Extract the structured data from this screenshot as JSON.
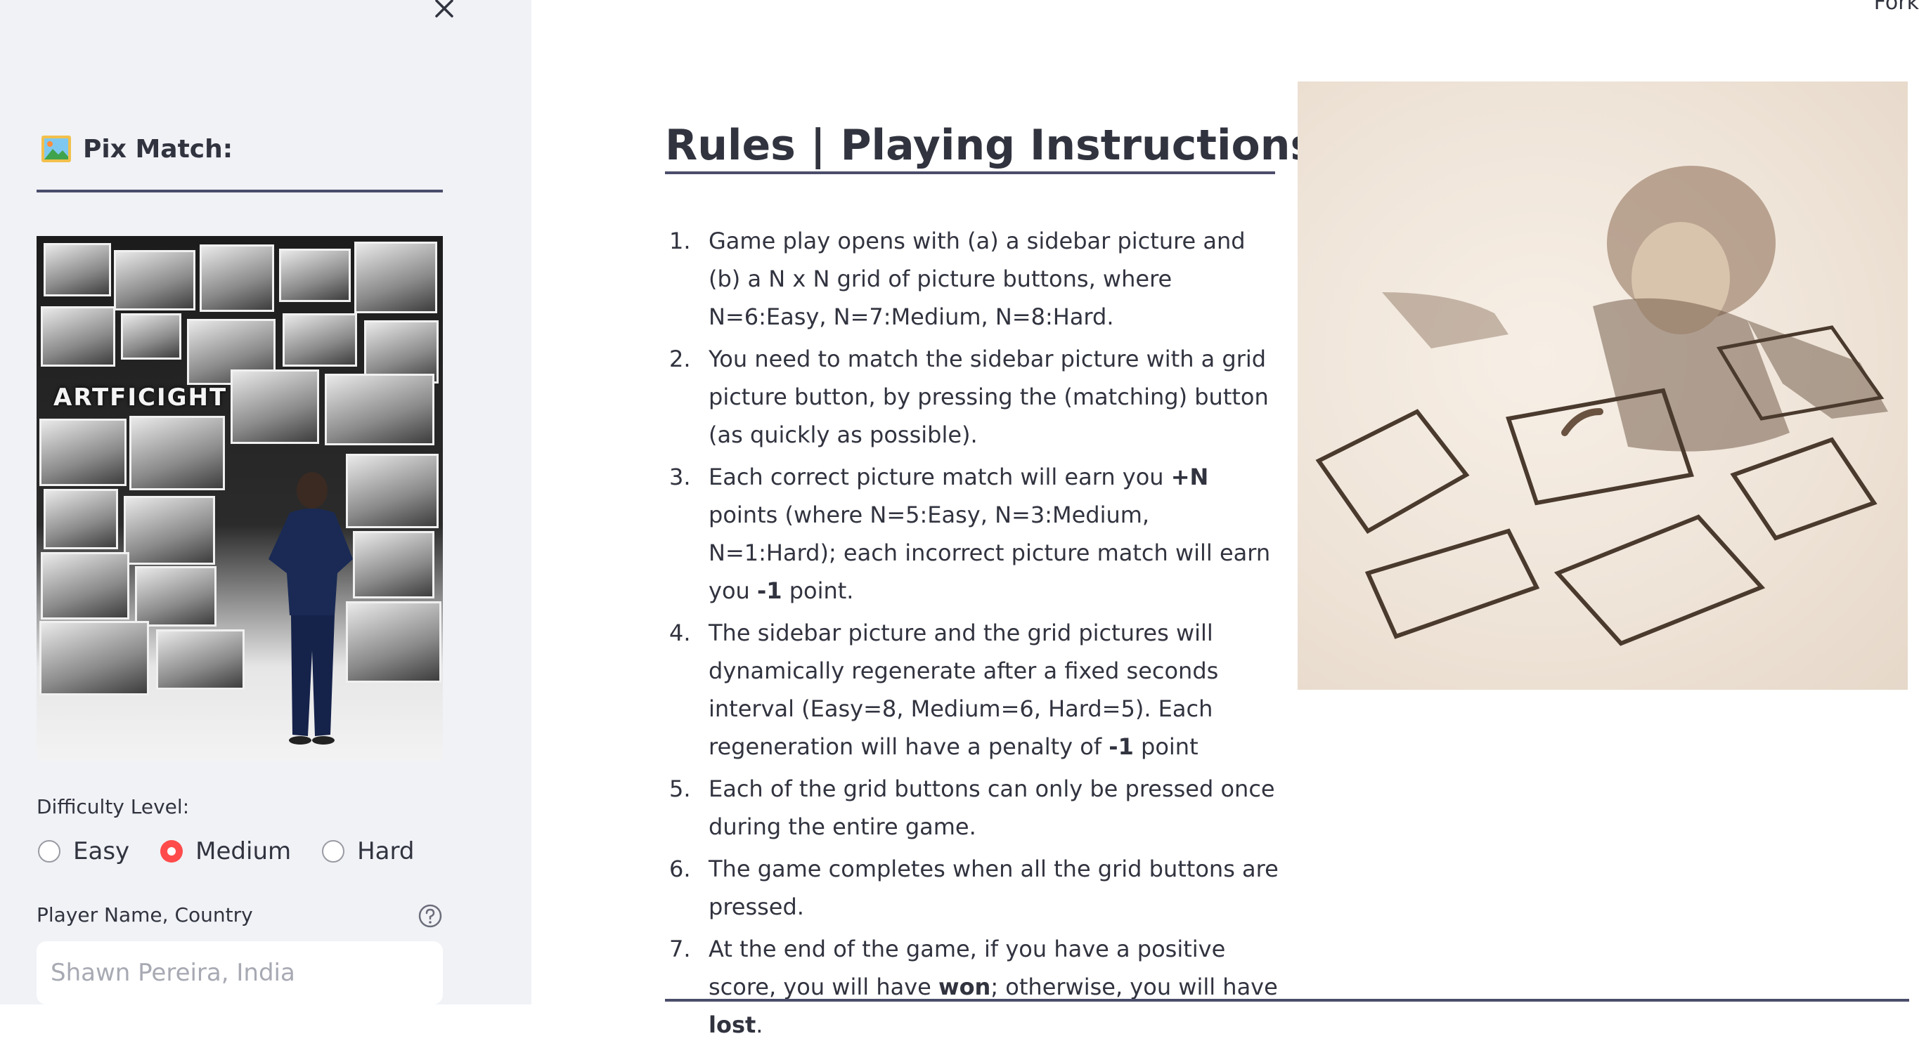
{
  "sidebar": {
    "title": "Pix Match:",
    "title_icon": "framed-picture-icon",
    "image_caption_text": "ARTFICIGHT",
    "difficulty": {
      "label": "Difficulty Level:",
      "options": [
        "Easy",
        "Medium",
        "Hard"
      ],
      "selected": "Medium"
    },
    "player": {
      "label": "Player Name, Country",
      "placeholder": "Shawn Pereira, India"
    }
  },
  "header": {
    "fork_label": "Fork"
  },
  "main": {
    "title": "Rules | Playing Instructions:",
    "rules": [
      {
        "num": "1.",
        "parts": [
          {
            "t": "Game play opens with (a) a sidebar picture and (b) a N x N grid of picture buttons, where N=6:Easy, N=7:Medium, N=8:Hard."
          }
        ]
      },
      {
        "num": "2.",
        "parts": [
          {
            "t": "You need to match the sidebar picture with a grid picture button, by pressing the (matching) button (as quickly as possible)."
          }
        ]
      },
      {
        "num": "3.",
        "parts": [
          {
            "t": "Each correct picture match will earn you "
          },
          {
            "t": "+N",
            "b": true
          },
          {
            "t": " points (where N=5:Easy, N=3:Medium, N=1:Hard); each incorrect picture match will earn you "
          },
          {
            "t": "-1",
            "b": true
          },
          {
            "t": " point."
          }
        ]
      },
      {
        "num": "4.",
        "parts": [
          {
            "t": "The sidebar picture and the grid pictures will dynamically regenerate after a fixed seconds interval (Easy=8, Medium=6, Hard=5). Each regeneration will have a penalty of "
          },
          {
            "t": "-1",
            "b": true
          },
          {
            "t": " point"
          }
        ]
      },
      {
        "num": "5.",
        "parts": [
          {
            "t": "Each of the grid buttons can only be pressed once during the entire game."
          }
        ]
      },
      {
        "num": "6.",
        "parts": [
          {
            "t": "The game completes when all the grid buttons are pressed."
          }
        ]
      },
      {
        "num": "7.",
        "parts": [
          {
            "t": "At the end of the game, if you have a positive score, you will have "
          },
          {
            "t": "won",
            "b": true
          },
          {
            "t": "; otherwise, you will have "
          },
          {
            "t": "lost",
            "b": true
          },
          {
            "t": "."
          }
        ]
      }
    ]
  },
  "colors": {
    "sidebar_bg": "#f0f2f6",
    "text": "#31333f",
    "rule": "#4b4d6b",
    "accent_radio": "#ff4b4b"
  }
}
